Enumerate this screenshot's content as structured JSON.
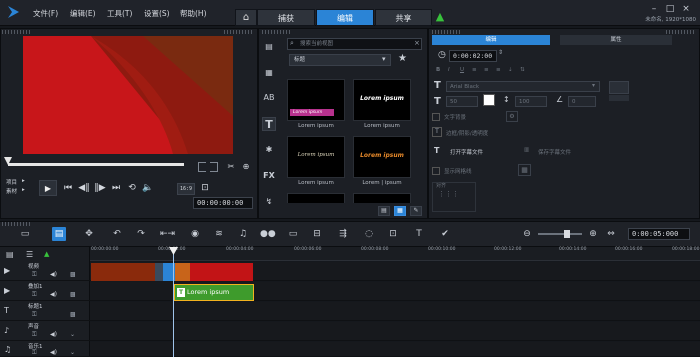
{
  "app": {
    "menu": [
      "文件(F)",
      "编辑(E)",
      "工具(T)",
      "设置(S)",
      "帮助(H)"
    ],
    "tabs": [
      {
        "label": "捕获",
        "active": false
      },
      {
        "label": "编辑",
        "active": true
      },
      {
        "label": "共享",
        "active": false
      }
    ],
    "project_name": "未命名, 1920*1080",
    "accent_color": "#2b84d6"
  },
  "player": {
    "mode_project": "项目",
    "mode_clip": "素材",
    "aspect_label": "16:9",
    "timecode": "00:00:00:00"
  },
  "library": {
    "search_placeholder": "搜索当前视图",
    "category": "标题",
    "thumbnails": [
      {
        "label": "Lorem ipsum",
        "preview": "Lorem ipsum"
      },
      {
        "label": "Lorem ipsum",
        "preview": "Lorem ipsum"
      },
      {
        "label": "Lorem ipsum",
        "preview": "Lorem ipsum"
      },
      {
        "label": "Lorem | ipsum",
        "preview": "Lorem ipsum"
      }
    ]
  },
  "options": {
    "tab_edit": "编辑",
    "tab_attr": "属性",
    "duration": "0:00:02:00",
    "font": "Arial Black",
    "font_size": "50",
    "line_spacing": "100",
    "angle": "0",
    "text_background_label": "文字背景",
    "border_shadow_label": "边框/阴影/透明度",
    "open_subtitle": "打开字幕文件",
    "save_subtitle": "保存字幕文件",
    "show_grid": "显示网格线",
    "align_label": "对齐"
  },
  "timeline": {
    "timecode": "0:00:05:000",
    "ruler": [
      "00:00:00:00",
      "00:00:02:00",
      "00:00:04:00",
      "00:00:06:00",
      "00:00:08:00",
      "00:00:10:00",
      "00:00:12:00",
      "00:00:14:00",
      "00:00:16:00",
      "00:00:18:00"
    ],
    "tracks": [
      "视频",
      "叠加1",
      "标题1",
      "声音",
      "音乐1"
    ],
    "title_clip": "Lorem ipsum"
  }
}
